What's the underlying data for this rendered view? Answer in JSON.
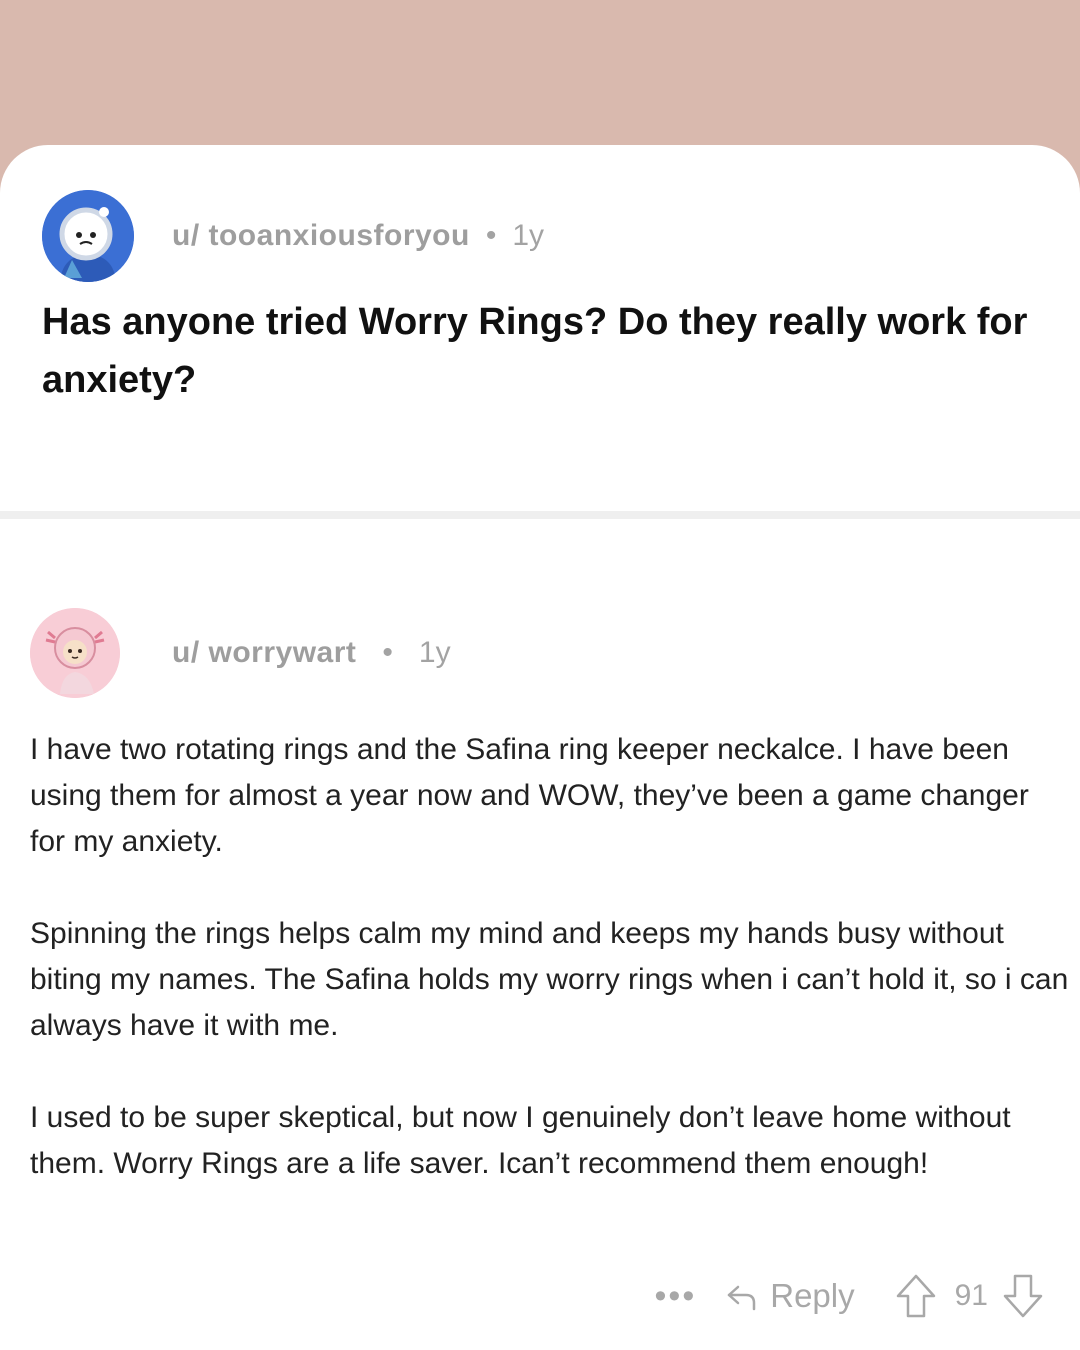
{
  "post": {
    "username": "u/ tooanxiousforyou",
    "age": "1y",
    "title": "Has anyone tried Worry Rings? Do they really work for anxiety?"
  },
  "comment": {
    "username": "u/ worrywart",
    "age": "1y",
    "paragraphs": [
      "I have two rotating rings and the Safina ring keeper neckalce. I have been using them for almost a year now and WOW, they’ve been a game changer for my anxiety.",
      "Spinning the rings helps calm my mind and keeps my hands busy without biting my names. The Safina holds my worry rings when i can’t hold it, so i can always have it with me.",
      "I used to be super skeptical, but now I genuinely don’t leave home without them. Worry Rings are a life saver. Ican’t recommend them enough!"
    ],
    "actions": {
      "more_label": "•••",
      "reply_label": "Reply",
      "vote_count": "91"
    }
  },
  "colors": {
    "background": "#d9b9ae",
    "card": "#ffffff",
    "op_avatar": "#3b6fd4",
    "commenter_avatar": "#f8cdd6"
  }
}
